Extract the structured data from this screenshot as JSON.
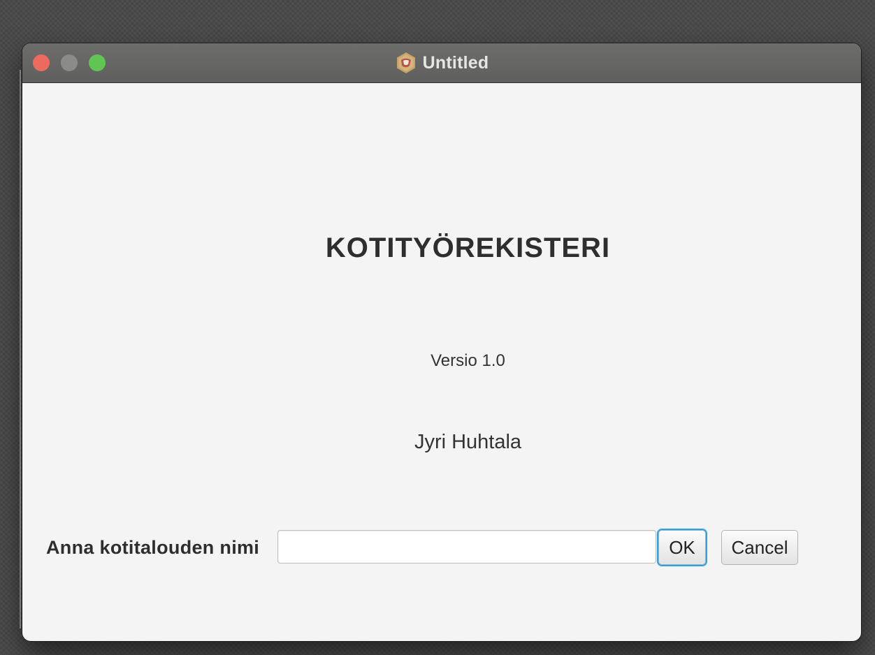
{
  "window": {
    "title": "Untitled",
    "app_icon": "app-logo-icon"
  },
  "main": {
    "heading": "KOTITYÖREKISTERI",
    "version": "Versio 1.0",
    "author": "Jyri Huhtala"
  },
  "form": {
    "label": "Anna kotitalouden nimi",
    "input_value": "",
    "input_placeholder": "",
    "ok_label": "OK",
    "cancel_label": "Cancel"
  },
  "colors": {
    "close": "#ed6a5e",
    "minimize": "#8b8b8a",
    "zoom": "#61c554",
    "focus_ring": "#2fa3dd"
  }
}
